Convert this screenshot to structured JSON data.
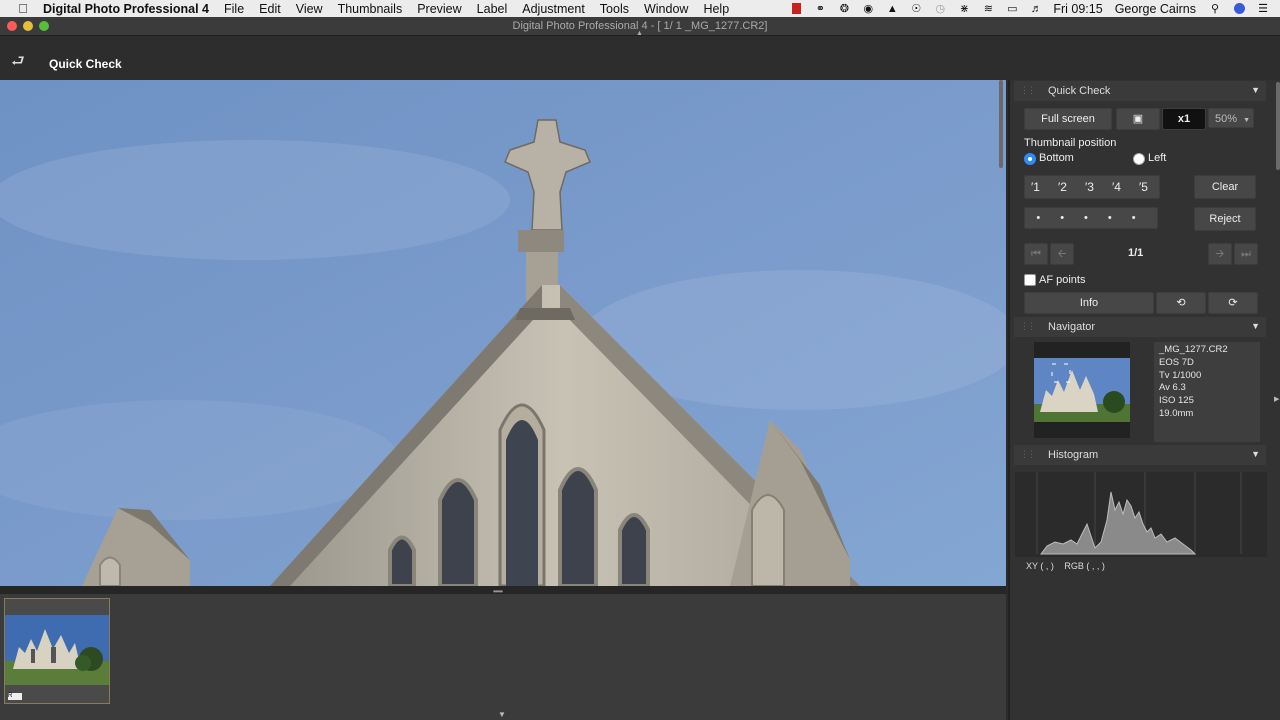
{
  "menubar": {
    "app_name": "Digital Photo Professional 4",
    "menus": [
      "File",
      "Edit",
      "View",
      "Thumbnails",
      "Preview",
      "Label",
      "Adjustment",
      "Tools",
      "Window",
      "Help"
    ],
    "clock": "Fri 09:15",
    "user": "George Cairns"
  },
  "window": {
    "title": "Digital Photo Professional 4 - [   1/   1 _MG_1277.CR2]"
  },
  "toolbar": {
    "title": "Quick Check"
  },
  "quick_check": {
    "header": "Quick Check",
    "full_screen": "Full screen",
    "zoom_1x": "x1",
    "zoom_pct": "50%",
    "thumb_pos_label": "Thumbnail position",
    "opt_bottom": "Bottom",
    "opt_left": "Left",
    "ratings": [
      "1",
      "2",
      "3",
      "4",
      "5"
    ],
    "clear": "Clear",
    "reject": "Reject",
    "page": "1/1",
    "af_points": "AF points",
    "info": "Info"
  },
  "navigator": {
    "header": "Navigator",
    "filename": "_MG_1277.CR2",
    "camera": "EOS 7D",
    "shutter": "Tv 1/1000",
    "aperture": "Av 6.3",
    "iso": "ISO 125",
    "focal": "19.0mm"
  },
  "histogram": {
    "header": "Histogram",
    "xy_label": "XY (        ,        )",
    "rgb_label": "RGB (        ,        ,        )"
  },
  "filmstrip": {
    "badge": "R"
  }
}
